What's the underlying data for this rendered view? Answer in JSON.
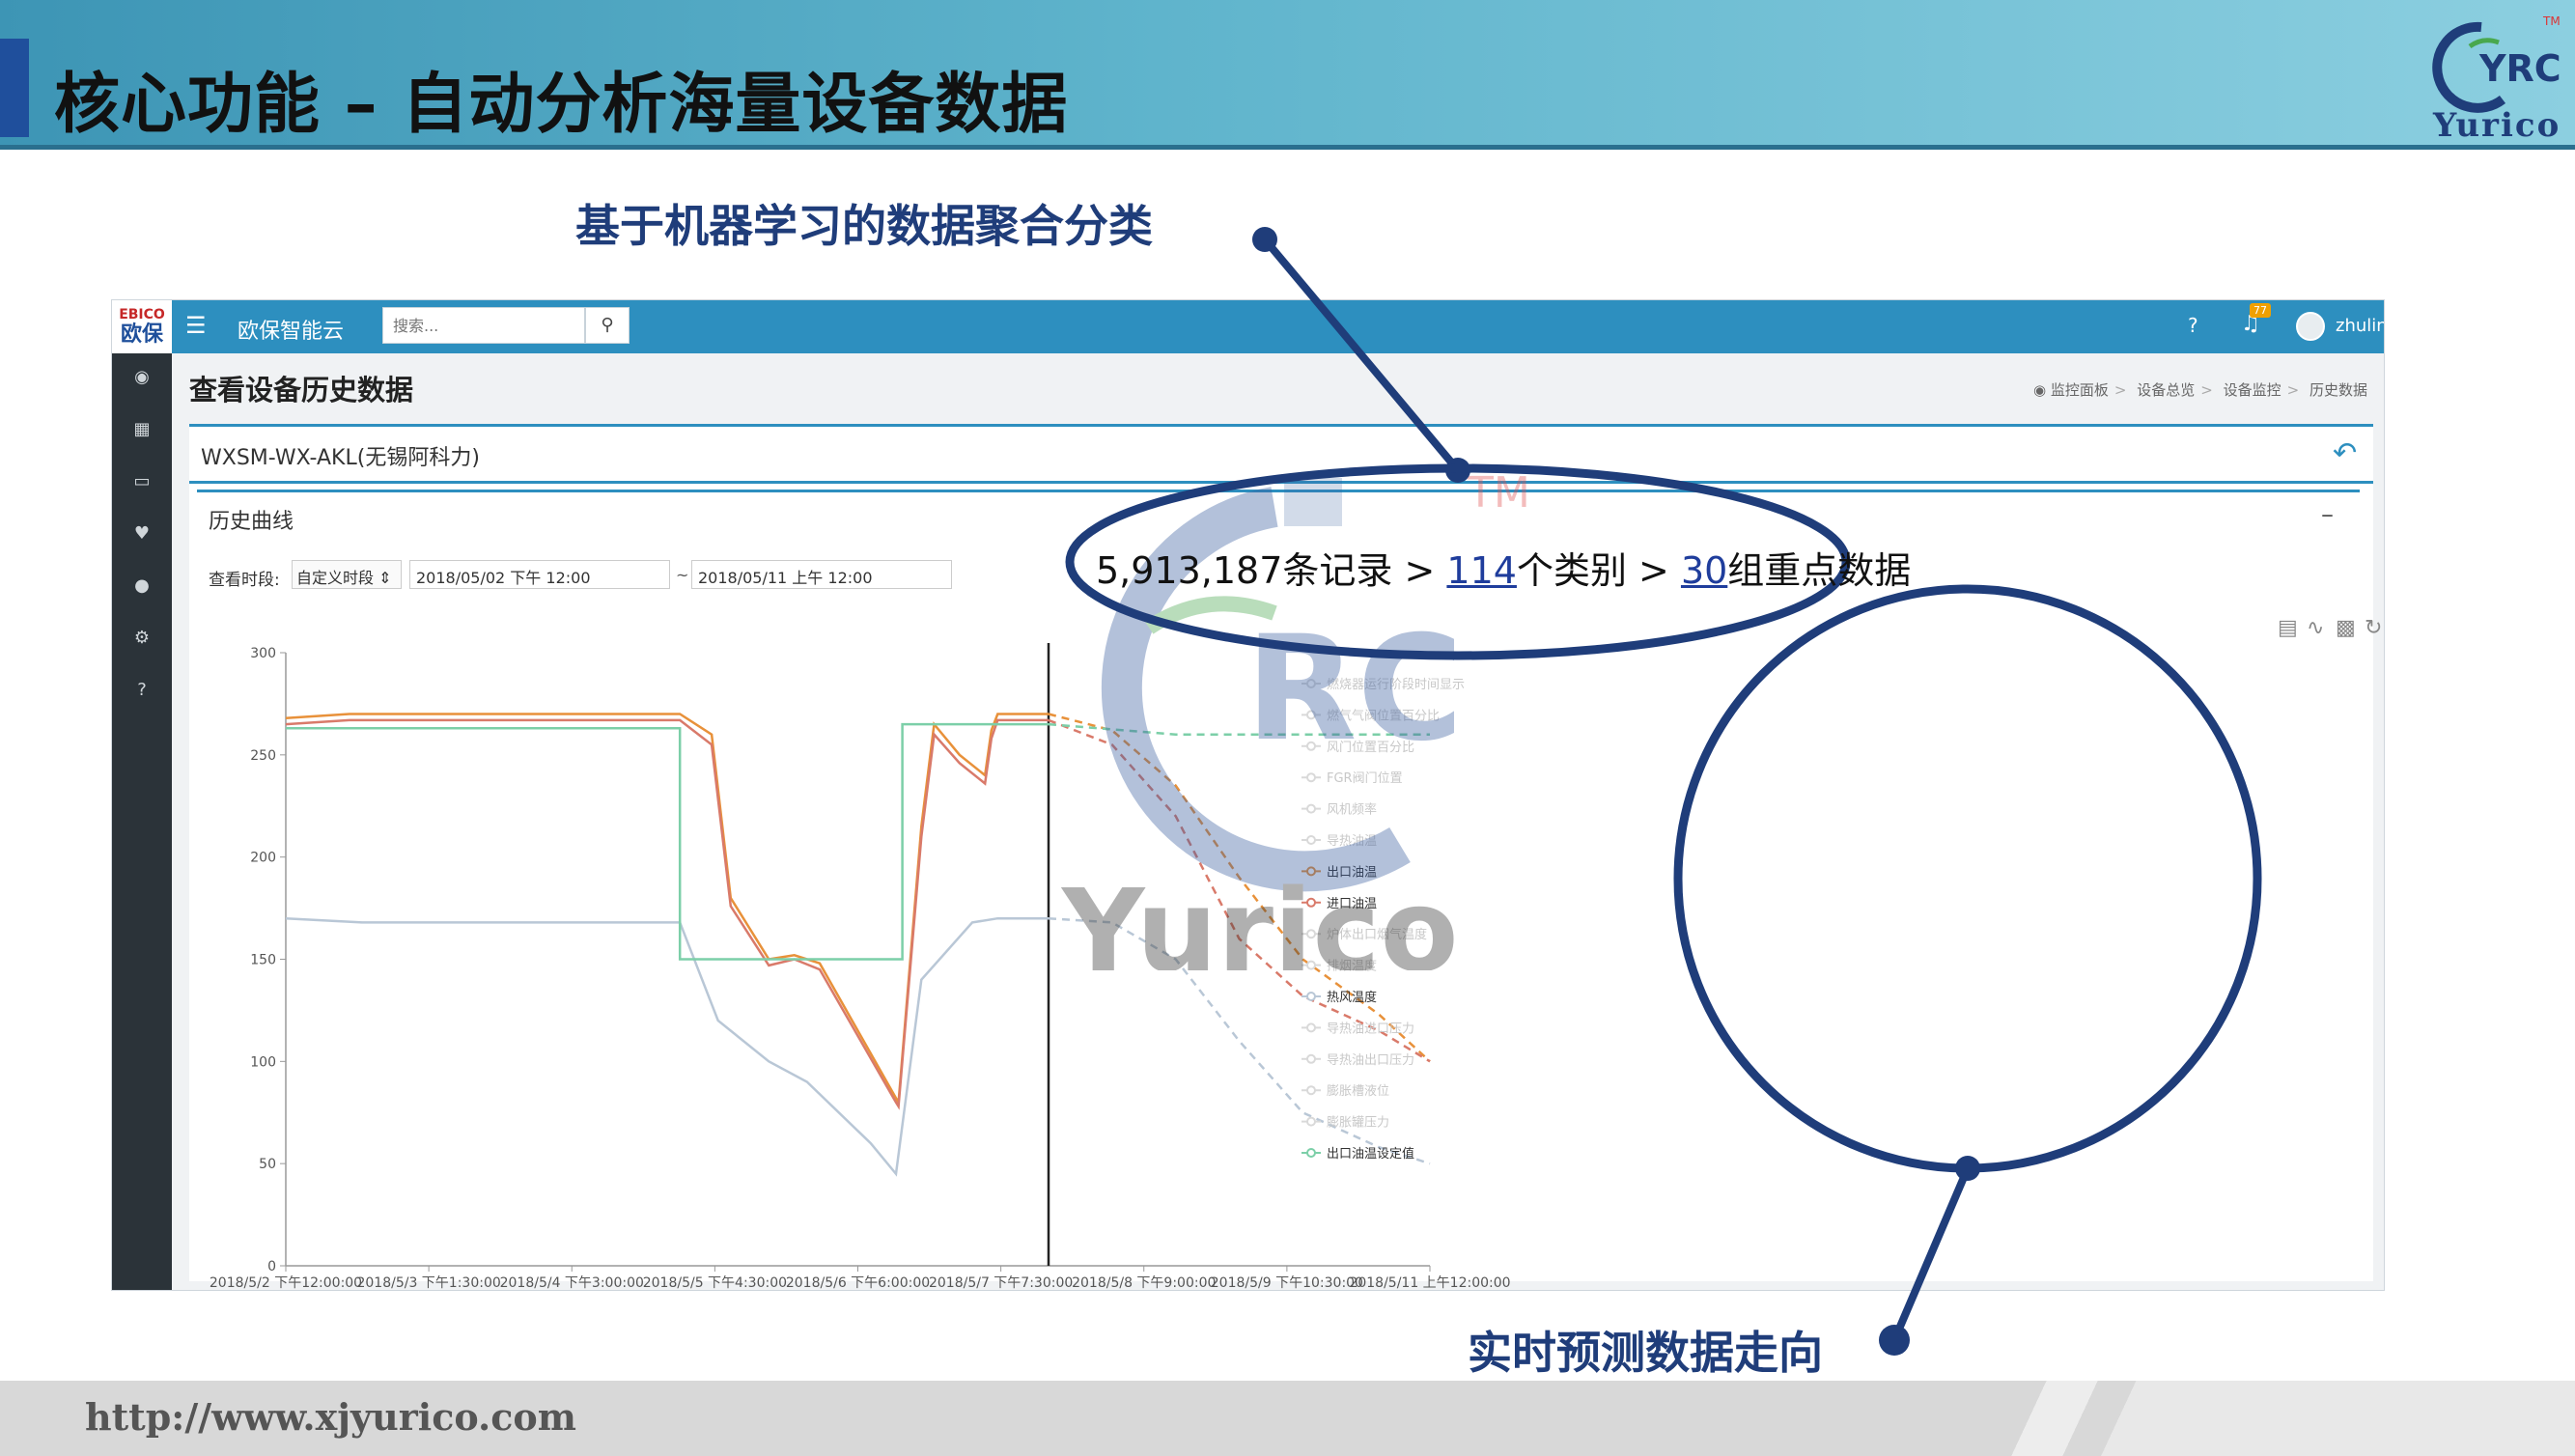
{
  "slide": {
    "title": "核心功能 – 自动分析海量设备数据",
    "logo_text": "Yurico",
    "logo_mark": "YRC",
    "logo_tm": "TM",
    "callout_top": "基于机器学习的数据聚合分类",
    "callout_bottom": "实时预测数据走向",
    "footer_url": "http://www.xjyurico.com",
    "accent_color": "#1f3d7a"
  },
  "stats": {
    "records": "5,913,187条记录 > ",
    "categories_num": "114",
    "categories_suffix": "个类别 > ",
    "groups_num": "30",
    "groups_suffix": "组重点数据"
  },
  "watermark": {
    "text": "Yurico",
    "mark": "RC",
    "tm": "TM"
  },
  "app": {
    "brand_top": "EBICO",
    "brand_bottom": "欧保",
    "name": "欧保智能云",
    "search_placeholder": "搜索...",
    "bell_badge": "77",
    "username": "zhulin",
    "page_title": "查看设备历史数据",
    "breadcrumb": [
      "监控面板",
      "设备总览",
      "设备监控",
      "历史数据"
    ],
    "device_name": "WXSM-WX-AKL(无锡阿科力)",
    "section_title": "历史曲线",
    "range_label": "查看时段:",
    "range_select": "自定义时段",
    "start_time": "2018/05/02 下午 12:00",
    "range_sep": "~",
    "end_time": "2018/05/11 上午 12:00",
    "sidebar_icons": [
      "dashboard-icon",
      "grid-icon",
      "monitor-icon",
      "heart-icon",
      "users-icon",
      "settings-icon",
      "help-icon"
    ]
  },
  "chart_data": {
    "type": "line",
    "ylim": [
      0,
      300
    ],
    "y_ticks": [
      "300",
      "250",
      "200",
      "150",
      "100",
      "50",
      "0"
    ],
    "x_tick_labels": [
      "2018/5/2 下午12:00:00",
      "2018/5/3 下午1:30:00",
      "2018/5/4 下午3:00:00",
      "2018/5/5 下午4:30:00",
      "2018/5/6 下午6:00:00",
      "2018/5/7 下午7:30:00",
      "2018/5/8 下午9:00:00",
      "2018/5/9 下午10:30:00",
      "2018/5/11 上午12:00:00"
    ],
    "legend": [
      "燃烧器运行阶段时间显示",
      "燃气气阀位置百分比",
      "风门位置百分比",
      "FGR阀门位置",
      "风机频率",
      "导热油温",
      "出口油温",
      "进口油温",
      "炉体出口烟气温度",
      "排烟温度",
      "热风温度",
      "导热油进口压力",
      "导热油出口压力",
      "膨胀槽液位",
      "膨胀罐压力",
      "出口油温设定值"
    ],
    "legend_colors": [
      "#d9d9d9",
      "#d9d9d9",
      "#d9d9d9",
      "#d9d9d9",
      "#d9d9d9",
      "#d9d9d9",
      "#e8913a",
      "#d97a6a",
      "#d9d9d9",
      "#d9d9d9",
      "#b9c7d6",
      "#d9d9d9",
      "#d9d9d9",
      "#d9d9d9",
      "#d9d9d9",
      "#7ccfa8"
    ],
    "x_range": [
      0,
      9
    ],
    "forecast_start_x": 6,
    "series": [
      {
        "name": "出口油温",
        "color": "#e8913a",
        "x": [
          0,
          0.5,
          2.1,
          3.1,
          3.35,
          3.5,
          3.8,
          4.0,
          4.2,
          4.8,
          4.82,
          5.0,
          5.1,
          5.3,
          5.5,
          5.55,
          5.6,
          6.0,
          6.5,
          7.0,
          7.5,
          8.0,
          8.6,
          9.0
        ],
        "y": [
          268,
          270,
          270,
          270,
          260,
          180,
          150,
          152,
          148,
          82,
          80,
          215,
          265,
          250,
          240,
          262,
          270,
          270,
          262,
          235,
          190,
          150,
          123,
          100
        ]
      },
      {
        "name": "进口油温",
        "color": "#d97a6a",
        "x": [
          0,
          0.5,
          2.1,
          3.1,
          3.35,
          3.5,
          3.8,
          4.0,
          4.2,
          4.8,
          4.82,
          5.0,
          5.1,
          5.3,
          5.5,
          5.55,
          5.6,
          6.0,
          6.5,
          7.0,
          7.5,
          8.0,
          8.6,
          9.0
        ],
        "y": [
          265,
          267,
          267,
          267,
          255,
          176,
          147,
          150,
          145,
          80,
          78,
          210,
          260,
          246,
          236,
          258,
          267,
          267,
          255,
          220,
          160,
          132,
          115,
          100
        ]
      },
      {
        "name": "热风温度",
        "color": "#b9c7d6",
        "x": [
          0,
          0.6,
          2.1,
          3.1,
          3.4,
          3.8,
          4.1,
          4.6,
          4.8,
          5.0,
          5.4,
          5.6,
          6.0,
          6.5,
          7.0,
          7.5,
          8.0,
          8.6,
          9.0
        ],
        "y": [
          170,
          168,
          168,
          168,
          120,
          100,
          90,
          60,
          45,
          140,
          168,
          170,
          170,
          168,
          150,
          110,
          75,
          58,
          50
        ]
      },
      {
        "name": "出口油温设定值",
        "color": "#7ccfa8",
        "x": [
          0,
          2.9,
          2.9,
          3.1,
          3.1,
          4.85,
          4.85,
          5.4,
          5.4,
          6.0,
          7.0,
          8.0,
          9.0
        ],
        "y": [
          263,
          263,
          263,
          263,
          150,
          150,
          265,
          265,
          265,
          265,
          260,
          260,
          260
        ]
      }
    ]
  }
}
